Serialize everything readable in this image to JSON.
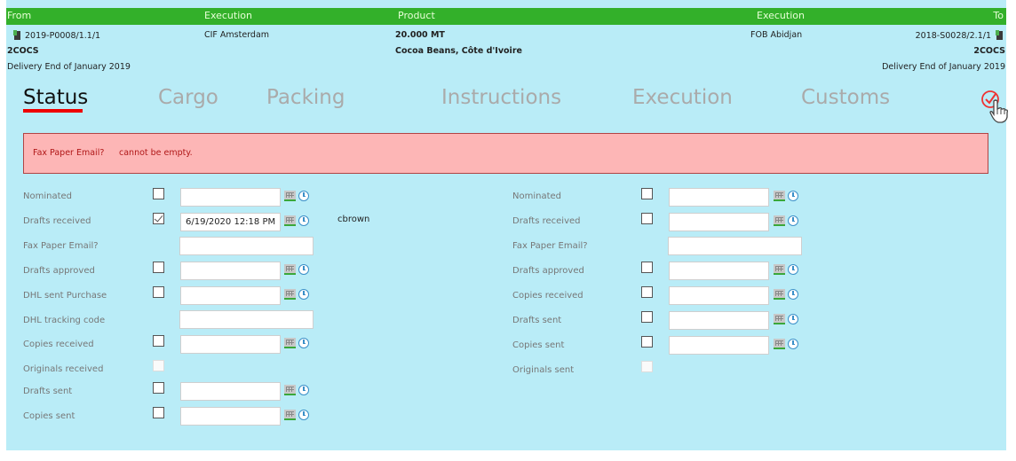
{
  "header": {
    "from": "From",
    "execution_left": "Execution",
    "product": "Product",
    "execution_right": "Execution",
    "to": "To"
  },
  "from_side": {
    "contract": "2019-P0008/1.1/1",
    "code": "2COCS",
    "delivery": "Delivery End of January 2019",
    "execution": "CIF Amsterdam"
  },
  "product": {
    "quantity": "20.000 MT",
    "name": "Cocoa Beans, Côte d'Ivoire"
  },
  "to_side": {
    "contract": "2018-S0028/2.1/1",
    "code": "2COCS",
    "delivery": "Delivery End of January 2019",
    "execution": "FOB Abidjan"
  },
  "tabs": [
    {
      "label": "Status",
      "active": true
    },
    {
      "label": "Cargo",
      "active": false
    },
    {
      "label": "Packing",
      "active": false
    },
    {
      "label": "Instructions",
      "active": false
    },
    {
      "label": "Execution",
      "active": false
    },
    {
      "label": "Customs",
      "active": false
    }
  ],
  "error": {
    "field": "Fax Paper Email?",
    "message": "cannot be empty."
  },
  "left_form": [
    {
      "label": "Nominated",
      "type": "datetime",
      "checked": false,
      "value": ""
    },
    {
      "label": "Drafts received",
      "type": "datetime",
      "checked": true,
      "value": "6/19/2020 12:18 PM",
      "user": "cbrown"
    },
    {
      "label": "Fax Paper Email?",
      "type": "text",
      "value": ""
    },
    {
      "label": "Drafts approved",
      "type": "datetime",
      "checked": false,
      "value": ""
    },
    {
      "label": "DHL sent Purchase",
      "type": "datetime",
      "checked": false,
      "value": ""
    },
    {
      "label": "DHL tracking code",
      "type": "text",
      "value": ""
    },
    {
      "label": "Copies received",
      "type": "datetime",
      "checked": false,
      "value": ""
    },
    {
      "label": "Originals received",
      "type": "checkbox-disabled",
      "checked": false
    },
    {
      "label": "Drafts sent",
      "type": "datetime",
      "checked": false,
      "value": ""
    },
    {
      "label": "Copies sent",
      "type": "datetime",
      "checked": false,
      "value": ""
    }
  ],
  "right_form": [
    {
      "label": "Nominated",
      "type": "datetime",
      "checked": false,
      "value": ""
    },
    {
      "label": "Drafts received",
      "type": "datetime",
      "checked": false,
      "value": ""
    },
    {
      "label": "Fax Paper Email?",
      "type": "text",
      "value": ""
    },
    {
      "label": "Drafts approved",
      "type": "datetime",
      "checked": false,
      "value": ""
    },
    {
      "label": "Copies received",
      "type": "datetime",
      "checked": false,
      "value": ""
    },
    {
      "label": "Drafts sent",
      "type": "datetime",
      "checked": false,
      "value": ""
    },
    {
      "label": "Copies sent",
      "type": "datetime",
      "checked": false,
      "value": ""
    },
    {
      "label": "Originals sent",
      "type": "checkbox-disabled",
      "checked": false
    }
  ],
  "colors": {
    "header_green": "#33b02a",
    "panel_blue": "#b9ecf7",
    "error_bg": "#fdb6b6",
    "error_text": "#b01818",
    "active_tab_underline": "#e00000"
  }
}
